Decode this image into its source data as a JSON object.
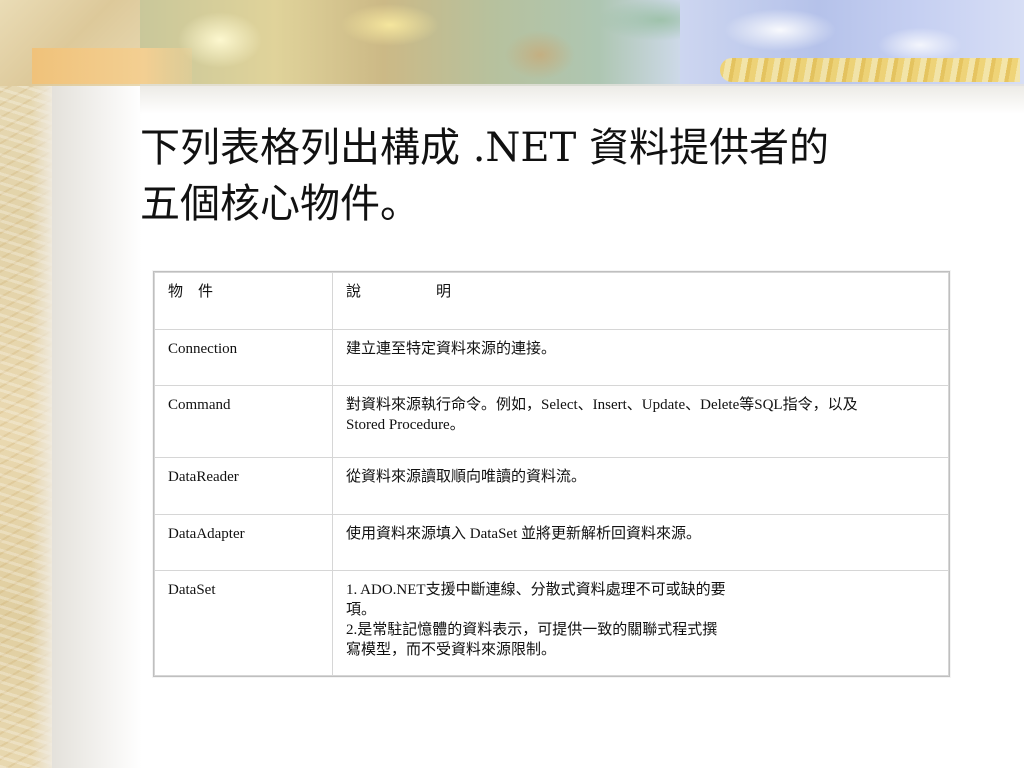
{
  "slide": {
    "title_line1": "下列表格列出構成 .NET 資料提供者的",
    "title_line2": "五個核心物件。"
  },
  "table": {
    "headers": [
      "物　件",
      "說　　　　　明"
    ],
    "rows": [
      {
        "object": "Connection",
        "description": [
          "建立連至特定資料來源的連接。"
        ]
      },
      {
        "object": "Command",
        "description": [
          "對資料來源執行命令。例如，Select、Insert、Update、Delete等SQL指令，以及",
          "Stored Procedure。"
        ]
      },
      {
        "object": "DataReader",
        "description": [
          "從資料來源讀取順向唯讀的資料流。"
        ]
      },
      {
        "object": "DataAdapter",
        "description": [
          "使用資料來源填入 DataSet 並將更新解析回資料來源。"
        ]
      },
      {
        "object": "DataSet",
        "description": [
          "1. ADO.NET支援中斷連線、分散式資料處理不可或缺的要",
          "項。",
          "2.是常駐記憶體的資料表示，可提供一致的關聯式程式撰",
          "寫模型，而不受資料來源限制。"
        ]
      }
    ]
  }
}
